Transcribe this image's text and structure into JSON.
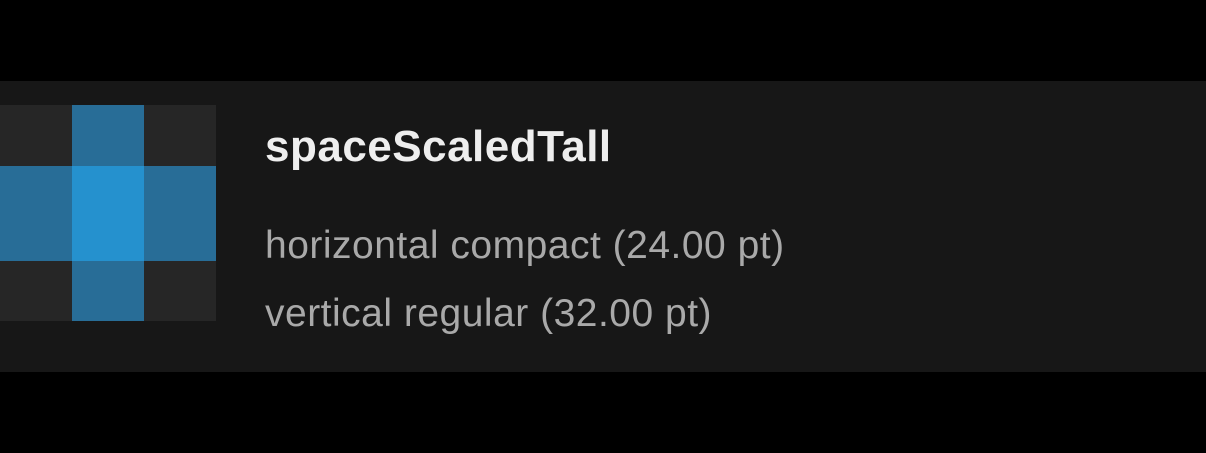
{
  "item": {
    "name": "spaceScaledTall",
    "horizontal": "horizontal compact (24.00 pt)",
    "vertical": "vertical regular (32.00 pt)"
  },
  "swatch": {
    "icon": "spacing-swatch-icon",
    "colors": {
      "background": "#171717",
      "corner": "#262626",
      "edge": "#286d97",
      "center": "#2591ce"
    }
  }
}
